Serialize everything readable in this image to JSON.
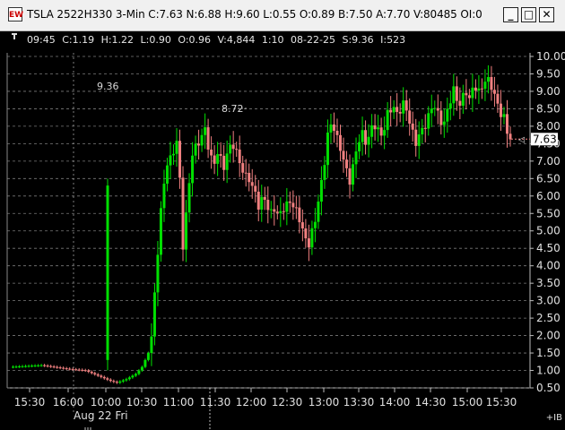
{
  "window": {
    "app_icon": "EW",
    "title": "TSLA 2522H330 3-Min C:7.63 N:6.88 H:9.60 L:0.55 O:0.89 B:7.50 A:7.70 V:80485 OI:0",
    "buttons": [
      "_",
      "□",
      "✕"
    ]
  },
  "info_bar": "09:45  C:1.19  H:1.22  L:0.90  O:0.96  V:4,844  1:10  08-22-25  S:9.36  I:523",
  "chart_data": {
    "type": "candlestick",
    "symbol": "TSLA 2522H330",
    "interval": "3-Min",
    "ylim": [
      0.45,
      10.1
    ],
    "y_ticks": [
      "10.00",
      "9.50",
      "9.00",
      "8.50",
      "8.00",
      "7.50",
      "7.00",
      "6.50",
      "6.00",
      "5.50",
      "5.00",
      "4.50",
      "4.00",
      "3.50",
      "3.00",
      "2.50",
      "2.00",
      "1.50",
      "1.00",
      "0.50"
    ],
    "x_ticks": [
      "15:30",
      "16:00",
      "10:00",
      "10:30",
      "11:00",
      "11:30",
      "12:00",
      "12:30",
      "13:00",
      "13:30",
      "14:00",
      "14:30",
      "15:00",
      "15:30"
    ],
    "date_label": "Aug 22 Fri",
    "annotations": [
      "9.36",
      "8.72"
    ],
    "last_price": "7.63",
    "corner_label": "+IB",
    "up_color": "#00e000",
    "down_color": "#f08080",
    "grid": true,
    "keypoints": [
      [
        0,
        1.1
      ],
      [
        10,
        1.15
      ],
      [
        18,
        1.05
      ],
      [
        24,
        1.0
      ],
      [
        28,
        0.85
      ],
      [
        32,
        0.7
      ],
      [
        34,
        0.65
      ],
      [
        37,
        0.75
      ],
      [
        40,
        0.9
      ],
      [
        42,
        1.1
      ],
      [
        44,
        1.5
      ],
      [
        45,
        2.0
      ],
      [
        46,
        3.2
      ],
      [
        47,
        4.5
      ],
      [
        48,
        5.6
      ],
      [
        49,
        6.3
      ],
      [
        50,
        6.9
      ],
      [
        51,
        7.0
      ],
      [
        52,
        7.3
      ],
      [
        53,
        7.65
      ],
      [
        54,
        6.5
      ],
      [
        55,
        4.6
      ],
      [
        56,
        5.4
      ],
      [
        57,
        6.3
      ],
      [
        58,
        7.2
      ],
      [
        59,
        7.4
      ],
      [
        60,
        7.6
      ],
      [
        61,
        7.8
      ],
      [
        62,
        7.9
      ],
      [
        63,
        7.4
      ],
      [
        64,
        7.0
      ],
      [
        65,
        6.9
      ],
      [
        66,
        7.3
      ],
      [
        67,
        7.1
      ],
      [
        68,
        6.9
      ],
      [
        69,
        7.2
      ],
      [
        70,
        7.35
      ],
      [
        71,
        7.4
      ],
      [
        72,
        7.2
      ],
      [
        73,
        7.0
      ],
      [
        74,
        6.8
      ],
      [
        75,
        6.6
      ],
      [
        76,
        6.5
      ],
      [
        77,
        6.2
      ],
      [
        78,
        6.0
      ],
      [
        79,
        5.7
      ],
      [
        80,
        5.9
      ],
      [
        81,
        6.0
      ],
      [
        82,
        5.7
      ],
      [
        83,
        5.5
      ],
      [
        84,
        5.6
      ],
      [
        85,
        5.4
      ],
      [
        86,
        5.5
      ],
      [
        87,
        5.7
      ],
      [
        88,
        5.8
      ],
      [
        89,
        5.9
      ],
      [
        90,
        5.7
      ],
      [
        91,
        5.5
      ],
      [
        92,
        5.3
      ],
      [
        93,
        5.0
      ],
      [
        94,
        4.8
      ],
      [
        95,
        4.7
      ],
      [
        96,
        5.0
      ],
      [
        97,
        5.3
      ],
      [
        98,
        5.8
      ],
      [
        99,
        6.3
      ],
      [
        100,
        7.0
      ],
      [
        101,
        7.8
      ],
      [
        102,
        8.1
      ],
      [
        103,
        8.0
      ],
      [
        104,
        7.6
      ],
      [
        105,
        7.3
      ],
      [
        106,
        7.0
      ],
      [
        107,
        6.7
      ],
      [
        108,
        6.5
      ],
      [
        109,
        6.9
      ],
      [
        110,
        7.3
      ],
      [
        111,
        7.6
      ],
      [
        112,
        7.7
      ],
      [
        113,
        7.5
      ],
      [
        114,
        7.7
      ],
      [
        115,
        8.0
      ],
      [
        116,
        8.1
      ],
      [
        117,
        7.9
      ],
      [
        118,
        7.7
      ],
      [
        119,
        7.9
      ],
      [
        120,
        8.3
      ],
      [
        121,
        8.5
      ],
      [
        122,
        8.6
      ],
      [
        123,
        8.4
      ],
      [
        124,
        8.5
      ],
      [
        125,
        8.6
      ],
      [
        126,
        8.4
      ],
      [
        127,
        8.1
      ],
      [
        128,
        7.8
      ],
      [
        129,
        7.6
      ],
      [
        130,
        7.8
      ],
      [
        131,
        7.9
      ],
      [
        132,
        8.0
      ],
      [
        133,
        8.2
      ],
      [
        134,
        8.5
      ],
      [
        135,
        8.6
      ],
      [
        136,
        8.4
      ],
      [
        137,
        8.2
      ],
      [
        138,
        8.1
      ],
      [
        139,
        8.4
      ],
      [
        140,
        8.7
      ],
      [
        141,
        9.0
      ],
      [
        142,
        8.8
      ],
      [
        143,
        8.7
      ],
      [
        144,
        8.9
      ],
      [
        145,
        9.0
      ],
      [
        146,
        8.7
      ],
      [
        147,
        9.0
      ],
      [
        148,
        9.1
      ],
      [
        149,
        9.0
      ],
      [
        150,
        9.2
      ],
      [
        151,
        9.36
      ],
      [
        152,
        9.3
      ],
      [
        153,
        9.1
      ],
      [
        154,
        8.8
      ],
      [
        155,
        8.6
      ],
      [
        156,
        8.4
      ],
      [
        157,
        8.3
      ],
      [
        158,
        7.9
      ],
      [
        159,
        7.63
      ]
    ]
  }
}
